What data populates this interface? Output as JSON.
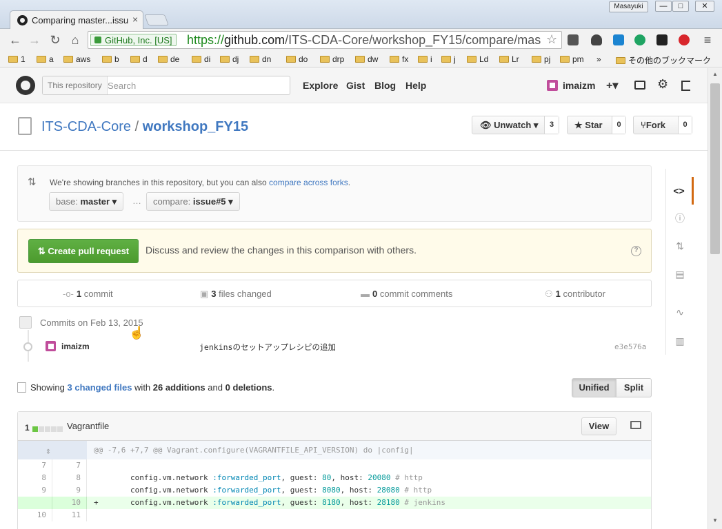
{
  "browser": {
    "tab_title": "Comparing master...issue",
    "tab_close": "×",
    "user_chip": "Masayuki",
    "win_min": "—",
    "win_max": "□",
    "win_close": "✕",
    "nav": {
      "back": "←",
      "forward": "→",
      "reload": "↻",
      "home": "⌂"
    },
    "ev_badge": "GitHub, Inc. [US]",
    "url_scheme": "https://",
    "url_host": "github.com",
    "url_path": "/ITS-CDA-Core/workshop_FY15/compare/mas",
    "star": "☆",
    "menu": "≡",
    "bookmarks": [
      "1",
      "a",
      "aws",
      "b",
      "d",
      "de",
      "di",
      "dj",
      "dn",
      "do",
      "drp",
      "dw",
      "fx",
      "i",
      "j",
      "Ld",
      "Lr",
      "pj",
      "pm"
    ],
    "more_bookmarks": "»",
    "other_bookmarks": "その他のブックマーク"
  },
  "header": {
    "search_scope": "This repository",
    "search_placeholder": "Search",
    "nav": [
      "Explore",
      "Gist",
      "Blog",
      "Help"
    ],
    "username": "imaizm",
    "plus": "+▾"
  },
  "repo": {
    "owner": "ITS-CDA-Core",
    "separator": "/",
    "name": "workshop_FY15",
    "unwatch_label": "Unwatch ▾",
    "unwatch_count": "3",
    "star_label": "Star",
    "star_count": "0",
    "fork_label": "Fork",
    "fork_count": "0"
  },
  "range": {
    "message": "We're showing branches in this repository, but you can also",
    "link": "compare across forks",
    "period": ".",
    "base_key": "base:",
    "base_value": "master ▾",
    "ellipsis": "…",
    "compare_key": "compare:",
    "compare_value": "issue#5 ▾"
  },
  "pull_request": {
    "button_label": "Create pull request",
    "message": "Discuss and review the changes in this comparison with others.",
    "help": "?"
  },
  "stats": {
    "commits_count": "1",
    "commits_label": "commit",
    "files_count": "3",
    "files_label": "files changed",
    "comments_count": "0",
    "comments_label": "commit comments",
    "contributors_count": "1",
    "contributors_label": "contributor"
  },
  "commits": {
    "day_label": "Commits on Feb 13, 2015",
    "items": [
      {
        "author": "imaizm",
        "message": "jenkinsのセットアップレシピの追加",
        "sha": "e3e576a"
      }
    ]
  },
  "summary": {
    "prefix": "Showing",
    "changed": "3 changed files",
    "with": "with",
    "additions": "26 additions",
    "and": "and",
    "deletions": "0 deletions",
    "period": ".",
    "unified_label": "Unified",
    "split_label": "Split"
  },
  "file": {
    "diff_count": "1",
    "blocks": {
      "added": 1,
      "total": 5
    },
    "name": "Vagrantfile",
    "view_label": "View",
    "hunk": "@@ -7,6 +7,7 @@ Vagrant.configure(VAGRANTFILE_API_VERSION) do |config|",
    "lines": [
      {
        "type": "context",
        "old": "7",
        "new": "7",
        "prefix": " ",
        "code": ""
      },
      {
        "type": "context",
        "old": "8",
        "new": "8",
        "prefix": " ",
        "code": "config.vm.network",
        "sym": ":forwarded_port",
        "k1": "guest: ",
        "n1": "80",
        "k2": ", host: ",
        "n2": "20080",
        "comment": " # http"
      },
      {
        "type": "context",
        "old": "9",
        "new": "9",
        "prefix": " ",
        "code": "config.vm.network",
        "sym": ":forwarded_port",
        "k1": "guest: ",
        "n1": "8080",
        "k2": ", host: ",
        "n2": "28080",
        "comment": " # http"
      },
      {
        "type": "add",
        "old": "",
        "new": "10",
        "prefix": "+",
        "code": "config.vm.network",
        "sym": ":forwarded_port",
        "k1": "guest: ",
        "n1": "8180",
        "k2": ", host: ",
        "n2": "28180",
        "comment": " # jenkins"
      },
      {
        "type": "context",
        "old": "10",
        "new": "11",
        "prefix": " ",
        "code": ""
      }
    ]
  },
  "colors": {
    "accent": "#4078c0",
    "pr_green": "#55a532",
    "nav_active": "#d26911"
  }
}
